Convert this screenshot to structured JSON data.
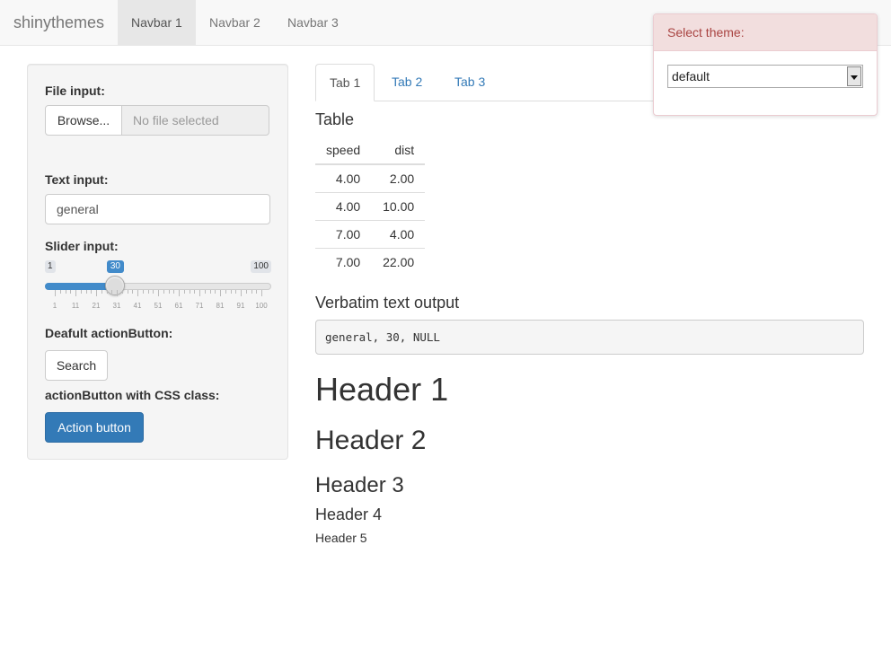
{
  "navbar": {
    "brand": "shinythemes",
    "items": [
      {
        "label": "Navbar 1",
        "active": true
      },
      {
        "label": "Navbar 2",
        "active": false
      },
      {
        "label": "Navbar 3",
        "active": false
      }
    ]
  },
  "sidebar": {
    "file_input": {
      "label": "File input:",
      "browse_label": "Browse...",
      "placeholder": "No file selected"
    },
    "text_input": {
      "label": "Text input:",
      "value": "general"
    },
    "slider": {
      "label": "Slider input:",
      "min": 1,
      "max": 100,
      "value": 30,
      "min_label": "1",
      "max_label": "100",
      "value_label": "30",
      "ticks": [
        "1",
        "11",
        "21",
        "31",
        "41",
        "51",
        "61",
        "71",
        "81",
        "91",
        "100"
      ]
    },
    "default_button": {
      "label": "Deafult actionButton:",
      "button_label": "Search"
    },
    "css_button": {
      "label": "actionButton with CSS class:",
      "button_label": "Action button"
    }
  },
  "main": {
    "tabs": [
      {
        "label": "Tab 1",
        "active": true
      },
      {
        "label": "Tab 2",
        "active": false
      },
      {
        "label": "Tab 3",
        "active": false
      }
    ],
    "table_heading": "Table",
    "table": {
      "headers": [
        "speed",
        "dist"
      ],
      "rows": [
        [
          "4.00",
          "2.00"
        ],
        [
          "4.00",
          "10.00"
        ],
        [
          "7.00",
          "4.00"
        ],
        [
          "7.00",
          "22.00"
        ]
      ]
    },
    "verbatim_heading": "Verbatim text output",
    "verbatim_text": "general, 30, NULL",
    "headers": {
      "h1": "Header 1",
      "h2": "Header 2",
      "h3": "Header 3",
      "h4": "Header 4",
      "h5": "Header 5"
    }
  },
  "theme_selector": {
    "heading": "Select theme:",
    "selected": "default"
  },
  "colors": {
    "primary": "#337ab7",
    "slider_accent": "#428bca",
    "theme_heading_bg": "#f2dede",
    "theme_heading_text": "#a94442"
  }
}
